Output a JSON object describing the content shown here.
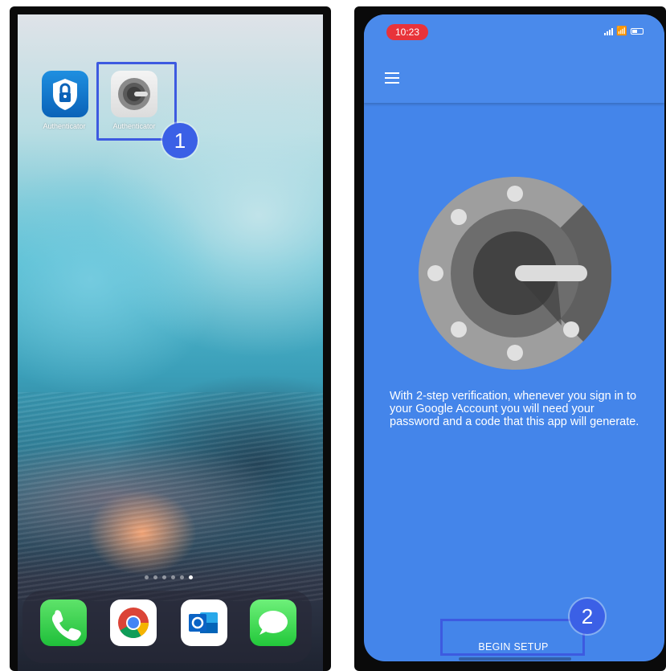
{
  "left_phone": {
    "apps": [
      {
        "label": "Authenticator",
        "icon": "microsoft-authenticator-icon"
      },
      {
        "label": "Authenticator",
        "icon": "google-authenticator-icon"
      }
    ],
    "step_badge": "1",
    "dock": [
      "phone-icon",
      "chrome-icon",
      "outlook-icon",
      "messages-icon"
    ]
  },
  "right_phone": {
    "status_time": "10:23",
    "description": "With 2-step verification, whenever you sign in to your Google Account you will need your password and a code that this app will generate.",
    "begin_setup_label": "BEGIN SETUP",
    "step_badge": "2",
    "colors": {
      "background": "#4485ea",
      "time_pill": "#e8333a",
      "highlight": "#3d5ae0"
    }
  }
}
